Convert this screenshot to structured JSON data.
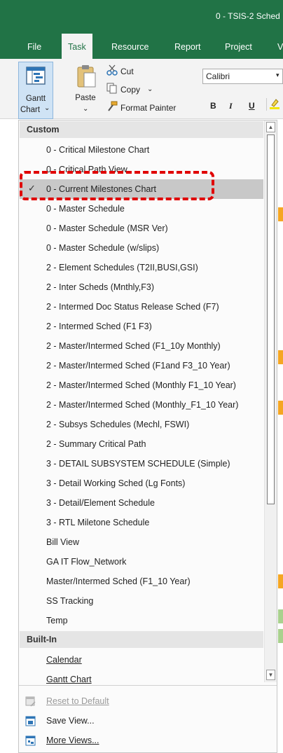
{
  "window": {
    "title": "0 - TSIS-2 Sched"
  },
  "tabs": [
    {
      "label": "File"
    },
    {
      "label": "Task"
    },
    {
      "label": "Resource"
    },
    {
      "label": "Report"
    },
    {
      "label": "Project"
    },
    {
      "label": "V"
    }
  ],
  "ribbon": {
    "gantt_line1": "Gantt",
    "gantt_line2": "Chart",
    "gantt_caret": "⌄",
    "paste": "Paste",
    "paste_caret": "⌄",
    "cut": "Cut",
    "copy": "Copy",
    "copy_caret": "⌄",
    "format_painter": "Format Painter",
    "font": "Calibri",
    "font_caret": "▾",
    "bold": "B",
    "italic": "I",
    "underline": "U"
  },
  "dropdown": {
    "custom_header": "Custom",
    "custom_items": [
      {
        "label": "0 - Critical Milestone Chart",
        "selected": false
      },
      {
        "label": "0 - Critical Path View",
        "selected": false
      },
      {
        "label": "0 - Current Milestones Chart",
        "selected": true
      },
      {
        "label": "0 - Master Schedule",
        "selected": false
      },
      {
        "label": "0 - Master Schedule (MSR Ver)",
        "selected": false
      },
      {
        "label": "0 - Master Schedule (w/slips)",
        "selected": false
      },
      {
        "label": "2 - Element Schedules (T2II,BUSI,GSI)",
        "selected": false
      },
      {
        "label": "2 - Inter Scheds (Mnthly,F3)",
        "selected": false
      },
      {
        "label": "2 - Intermed Doc Status Release Sched (F7)",
        "selected": false
      },
      {
        "label": "2 - Intermed Sched (F1 F3)",
        "selected": false
      },
      {
        "label": "2 - Master/Intermed Sched (F1_10y Monthly)",
        "selected": false
      },
      {
        "label": "2 - Master/Intermed Sched (F1and F3_10 Year)",
        "selected": false
      },
      {
        "label": "2 - Master/Intermed Sched (Monthly F1_10 Year)",
        "selected": false
      },
      {
        "label": "2 - Master/Intermed Sched (Monthly_F1_10 Year)",
        "selected": false
      },
      {
        "label": "2 - Subsys  Schedules (Mechl, FSWI)",
        "selected": false
      },
      {
        "label": "2 - Summary Critical Path",
        "selected": false
      },
      {
        "label": "3 - DETAIL SUBSYSTEM SCHEDULE (Simple)",
        "selected": false
      },
      {
        "label": "3 - Detail Working Sched (Lg Fonts)",
        "selected": false
      },
      {
        "label": "3 - Detail/Element Schedule",
        "selected": false
      },
      {
        "label": "3 - RTL Miletone Schedule",
        "selected": false
      },
      {
        "label": "Bill View",
        "selected": false
      },
      {
        "label": "GA IT Flow_Network",
        "selected": false
      },
      {
        "label": "Master/Intermed Sched (F1_10 Year)",
        "selected": false
      },
      {
        "label": "SS Tracking",
        "selected": false
      },
      {
        "label": "Temp",
        "selected": false
      }
    ],
    "builtin_header": "Built-In",
    "builtin_items": [
      {
        "label": "Calendar"
      },
      {
        "label": "Gantt Chart"
      }
    ],
    "check_glyph": "✓",
    "scroll_up": "▲",
    "scroll_down": "▼",
    "footer": {
      "reset": "Reset to Default",
      "save": "Save View...",
      "more": "More Views..."
    }
  },
  "colors": {
    "brand_green": "#217346",
    "highlight_red": "#e00000",
    "selected_row": "#c8c8c8"
  },
  "icons": [
    "gantt-chart-icon",
    "paste-icon",
    "scissors-icon",
    "copy-icon",
    "format-painter-icon",
    "checkmark-icon",
    "reset-view-icon",
    "save-view-icon",
    "more-views-icon"
  ]
}
